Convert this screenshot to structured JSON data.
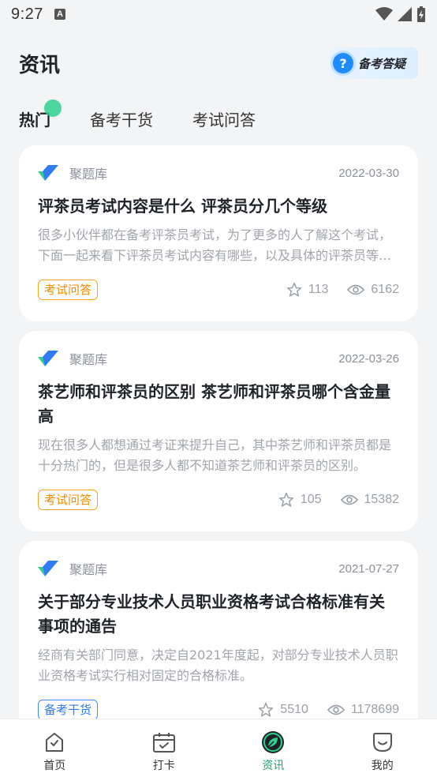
{
  "status_bar": {
    "time": "9:27",
    "notification_icon": "A"
  },
  "header": {
    "title": "资讯",
    "qa_badge_label": "备考答疑"
  },
  "tabs": [
    {
      "label": "热门",
      "active": true
    },
    {
      "label": "备考干货",
      "active": false
    },
    {
      "label": "考试问答",
      "active": false
    }
  ],
  "articles": [
    {
      "source": "聚题库",
      "date": "2022-03-30",
      "title": "评茶员考试内容是什么 评茶员分几个等级",
      "summary": "很多小伙伴都在备考评茶员考试，为了更多的人了解这个考试，下面一起来看下评茶员考试内容有哪些，以及具体的评茶员等级划分。",
      "tag": "考试问答",
      "likes": "113",
      "views": "6162"
    },
    {
      "source": "聚题库",
      "date": "2022-03-26",
      "title": "茶艺师和评茶员的区别 茶艺师和评茶员哪个含金量高",
      "summary": "现在很多人都想通过考证来提升自己，其中茶艺师和评茶员都是十分热门的，但是很多人都不知道茶艺师和评茶员的区别。",
      "tag": "考试问答",
      "likes": "105",
      "views": "15382"
    },
    {
      "source": "聚题库",
      "date": "2021-07-27",
      "title": "关于部分专业技术人员职业资格考试合格标准有关事项的通告",
      "summary": "经商有关部门同意，决定自2021年度起，对部分专业技术人员职业资格考试实行相对固定的合格标准。",
      "tag": "备考干货",
      "likes": "5510",
      "views": "1178699"
    }
  ],
  "bottom_nav": [
    {
      "label": "首页",
      "icon": "home-icon"
    },
    {
      "label": "打卡",
      "icon": "calendar-check-icon"
    },
    {
      "label": "资讯",
      "icon": "leaf-icon",
      "active": true
    },
    {
      "label": "我的",
      "icon": "profile-icon"
    }
  ],
  "colors": {
    "accent_green": "#1aa86a",
    "tag_orange": "#f08c00",
    "tag_blue": "#2f7cf5"
  }
}
